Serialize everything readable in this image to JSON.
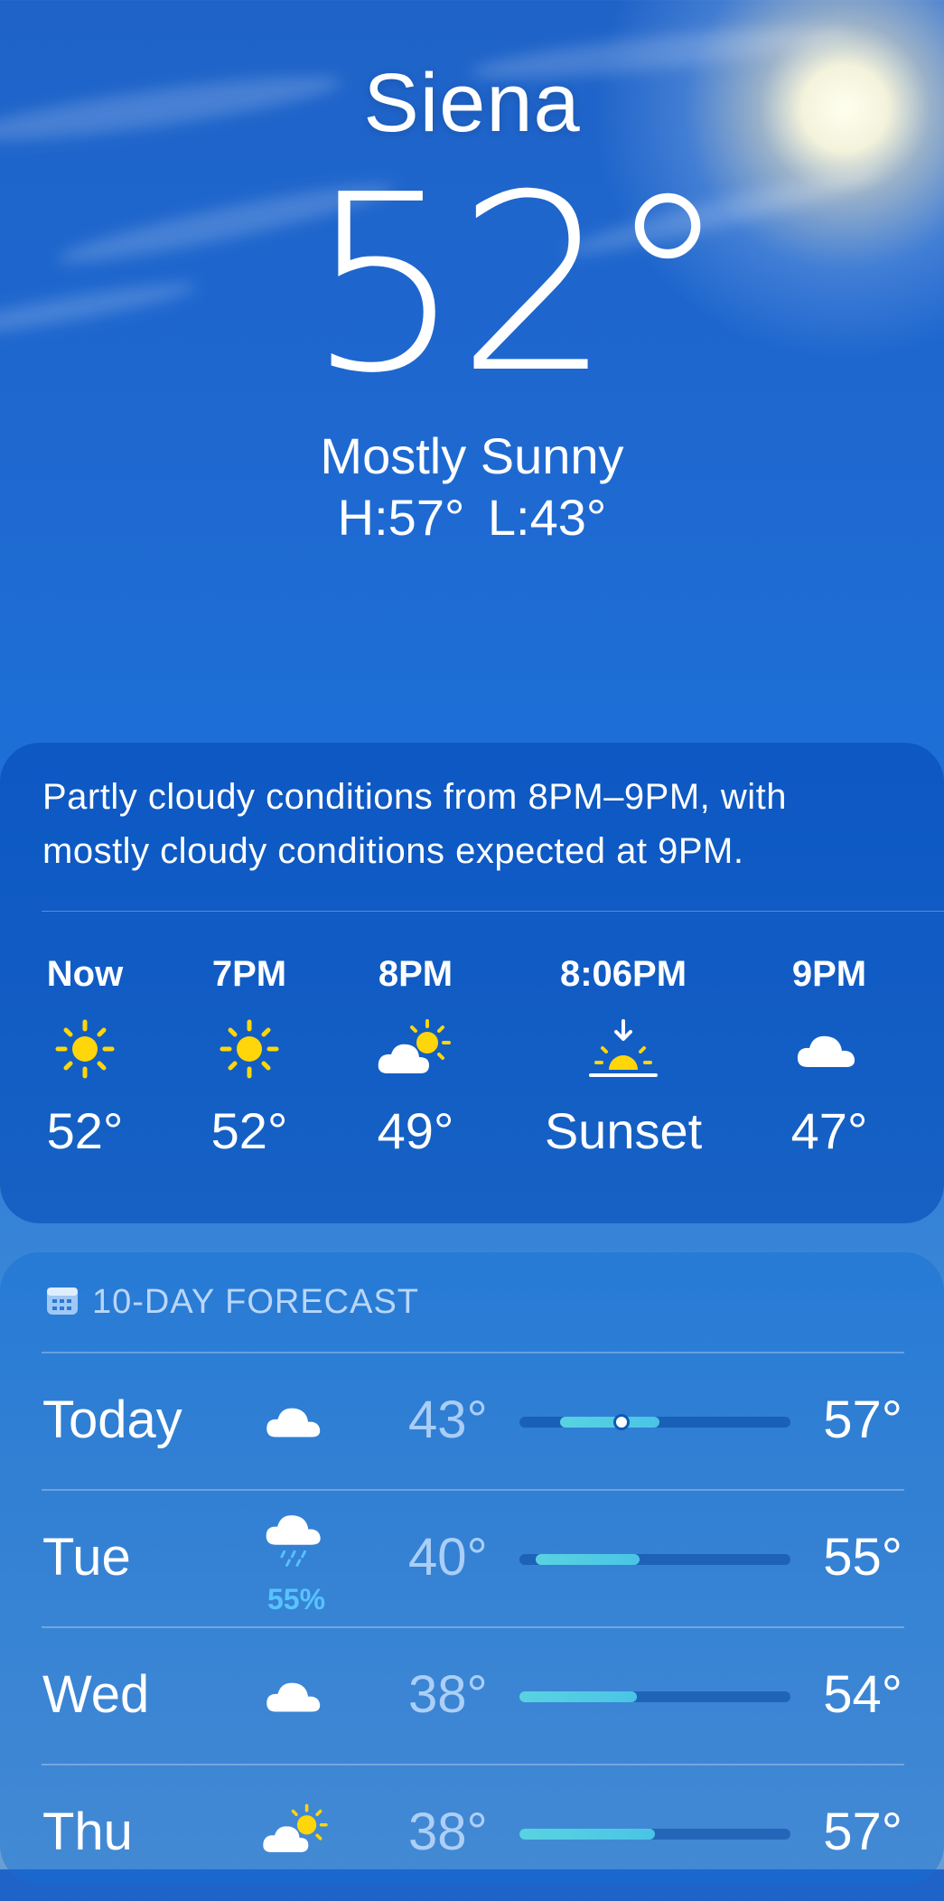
{
  "location": {
    "city": "Siena",
    "temperature": "52°",
    "condition": "Mostly Sunny",
    "high_low": "H:57°  L:43°"
  },
  "hourly": {
    "summary": "Partly cloudy conditions from 8PM–9PM, with mostly cloudy conditions expected at 9PM.",
    "items": [
      {
        "label": "Now",
        "icon": "sun-icon",
        "temp": "52°"
      },
      {
        "label": "7PM",
        "icon": "sun-icon",
        "temp": "52°"
      },
      {
        "label": "8PM",
        "icon": "partly-cloudy-icon",
        "temp": "49°"
      },
      {
        "label": "8:06PM",
        "icon": "sunset-icon",
        "temp": "Sunset"
      },
      {
        "label": "9PM",
        "icon": "cloud-icon",
        "temp": "47°"
      }
    ]
  },
  "forecast": {
    "title": "10-DAY FORECAST",
    "icon": "calendar-icon",
    "days": [
      {
        "day": "Today",
        "icon": "cloud-icon",
        "precip": "",
        "low": "43°",
        "high": "57°"
      },
      {
        "day": "Tue",
        "icon": "rain-cloud-icon",
        "precip": "55%",
        "low": "40°",
        "high": "55°"
      },
      {
        "day": "Wed",
        "icon": "cloud-icon",
        "precip": "",
        "low": "38°",
        "high": "54°"
      },
      {
        "day": "Thu",
        "icon": "partly-cloudy-icon",
        "precip": "",
        "low": "38°",
        "high": "57°"
      }
    ]
  },
  "colors": {
    "sun": "#ffd60a",
    "bar_fill": "#55cfe2",
    "precip": "#57c3ff"
  }
}
